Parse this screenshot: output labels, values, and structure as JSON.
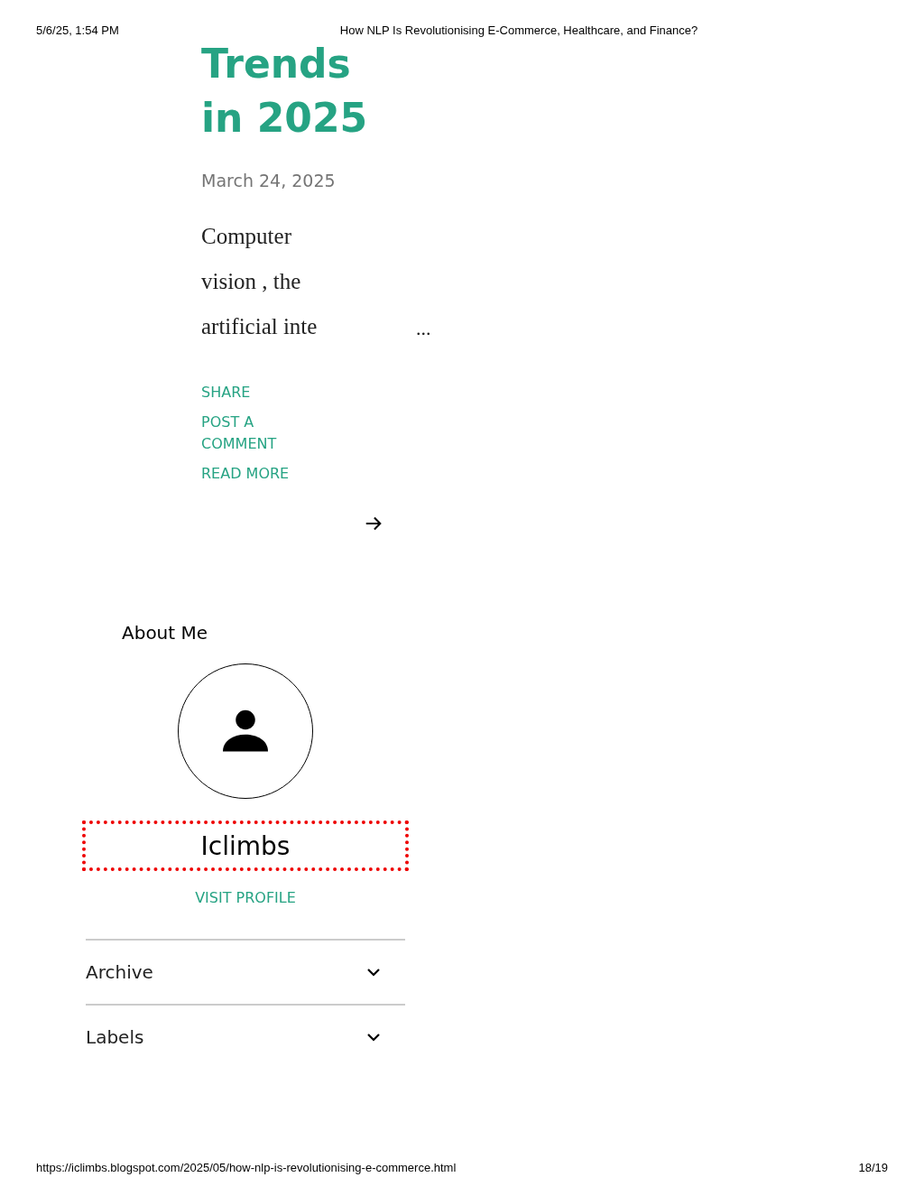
{
  "header": {
    "datetime": "5/6/25, 1:54 PM",
    "title": "How NLP Is Revolutionising E-Commerce, Healthcare, and Finance?"
  },
  "post": {
    "title": "Trends in 2025",
    "date": "March 24, 2025",
    "snippet": "Computer vision , the artificial inte",
    "ellipsis": "...",
    "actions": [
      "SHARE",
      "POST A COMMENT",
      "READ MORE"
    ]
  },
  "about": {
    "heading": "About Me",
    "name": "Iclimbs",
    "highlighted": true,
    "link": "VISIT PROFILE"
  },
  "sections": [
    {
      "label": "Archive",
      "expanded": false
    },
    {
      "label": "Labels",
      "expanded": false
    }
  ],
  "footer": {
    "url": "https://iclimbs.blogspot.com/2025/05/how-nlp-is-revolutionising-e-commerce.html",
    "page": "18/19"
  }
}
